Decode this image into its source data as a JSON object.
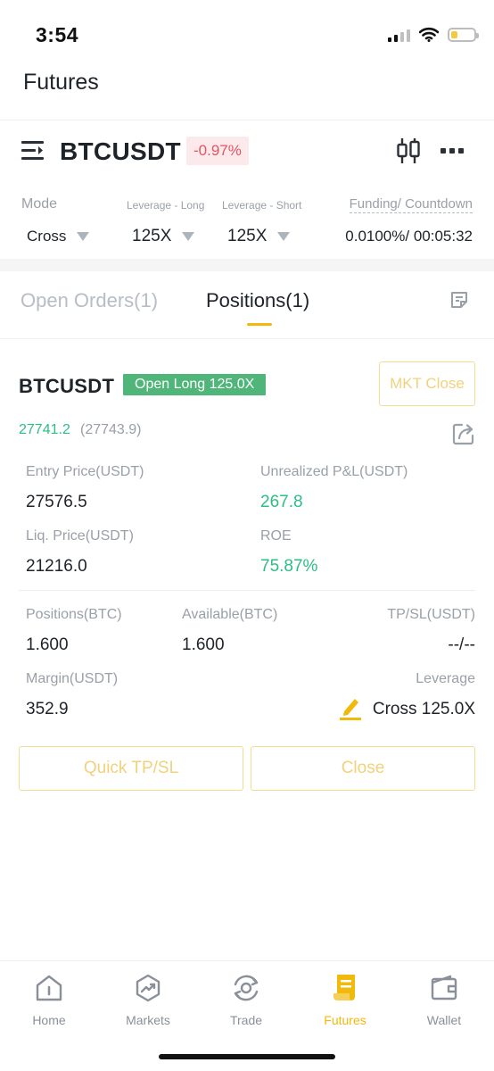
{
  "status_bar": {
    "time": "3:54"
  },
  "header": {
    "title": "Futures"
  },
  "ticker": {
    "symbol": "BTCUSDT",
    "change": "-0.97%"
  },
  "params": {
    "mode_label": "Mode",
    "mode_value": "Cross",
    "leverage_long_label": "Leverage - Long",
    "leverage_long_value": "125X",
    "leverage_short_label": "Leverage - Short",
    "leverage_short_value": "125X",
    "funding_label": "Funding/ Countdown",
    "funding_value": "0.0100%/ 00:05:32"
  },
  "tabs": {
    "open_orders": "Open Orders(1)",
    "positions": "Positions(1)",
    "active": "positions"
  },
  "position": {
    "symbol": "BTCUSDT",
    "badge": "Open Long 125.0X",
    "mkt_close": "MKT Close",
    "last_price": "27741.2",
    "mark_price": "(27743.9)",
    "entry_price_label": "Entry Price(USDT)",
    "entry_price": "27576.5",
    "unrealized_pnl_label": "Unrealized P&L(USDT)",
    "unrealized_pnl": "267.8",
    "liq_price_label": "Liq. Price(USDT)",
    "liq_price": "21216.0",
    "roe_label": "ROE",
    "roe": "75.87%",
    "positions_label": "Positions(BTC)",
    "positions_value": "1.600",
    "available_label": "Available(BTC)",
    "available_value": "1.600",
    "tpsl_label": "TP/SL(USDT)",
    "tpsl_value": "--/--",
    "margin_label": "Margin(USDT)",
    "margin_value": "352.9",
    "leverage_label": "Leverage",
    "leverage_value": "Cross 125.0X",
    "quick_tpsl_button": "Quick TP/SL",
    "close_button": "Close"
  },
  "bottom_nav": [
    {
      "label": "Home",
      "icon": "home-icon"
    },
    {
      "label": "Markets",
      "icon": "markets-icon"
    },
    {
      "label": "Trade",
      "icon": "trade-icon"
    },
    {
      "label": "Futures",
      "icon": "futures-icon",
      "active": true
    },
    {
      "label": "Wallet",
      "icon": "wallet-icon"
    }
  ],
  "colors": {
    "accent": "#f0b90b",
    "positive": "#2ebd85",
    "negative": "#e25563",
    "muted": "#9aa0a8"
  }
}
